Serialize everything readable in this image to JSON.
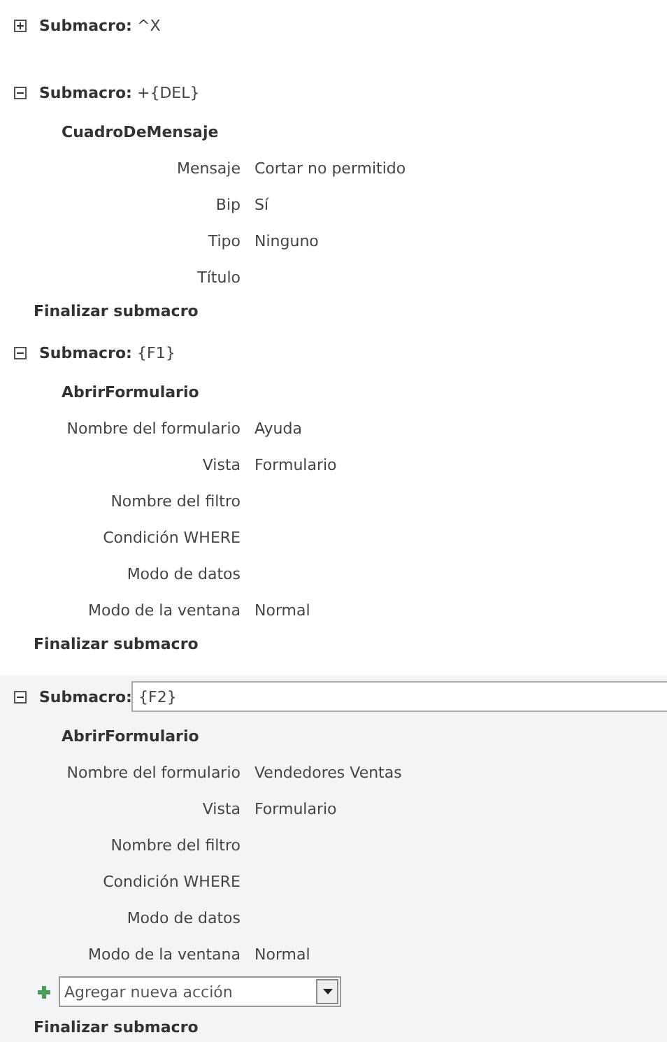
{
  "submacros": [
    {
      "label": "Submacro:",
      "name": "^X",
      "expanded": false,
      "selected": false
    },
    {
      "label": "Submacro:",
      "name": "+{DEL}",
      "expanded": true,
      "selected": false,
      "actions": [
        {
          "name": "CuadroDeMensaje",
          "args": [
            {
              "label": "Mensaje",
              "value": "Cortar no permitido"
            },
            {
              "label": "Bip",
              "value": "Sí"
            },
            {
              "label": "Tipo",
              "value": "Ninguno"
            },
            {
              "label": "Título"
            }
          ]
        }
      ],
      "end_label": "Finalizar submacro"
    },
    {
      "label": "Submacro:",
      "name": "{F1}",
      "expanded": true,
      "selected": false,
      "actions": [
        {
          "name": "AbrirFormulario",
          "args": [
            {
              "label": "Nombre del formulario",
              "value": "Ayuda"
            },
            {
              "label": "Vista",
              "value": "Formulario"
            },
            {
              "label": "Nombre del filtro"
            },
            {
              "label": "Condición WHERE"
            },
            {
              "label": "Modo de datos"
            },
            {
              "label": "Modo de la ventana",
              "value": "Normal"
            }
          ]
        }
      ],
      "end_label": "Finalizar submacro"
    },
    {
      "label": "Submacro:",
      "name": "{F2}",
      "expanded": true,
      "selected": true,
      "actions": [
        {
          "name": "AbrirFormulario",
          "args": [
            {
              "label": "Nombre del formulario",
              "value": "Vendedores Ventas"
            },
            {
              "label": "Vista",
              "value": "Formulario"
            },
            {
              "label": "Nombre del filtro"
            },
            {
              "label": "Condición WHERE"
            },
            {
              "label": "Modo de datos"
            },
            {
              "label": "Modo de la ventana",
              "value": "Normal"
            }
          ]
        }
      ],
      "add_action": {
        "placeholder": "Agregar nueva acción"
      },
      "end_label": "Finalizar submacro"
    }
  ]
}
